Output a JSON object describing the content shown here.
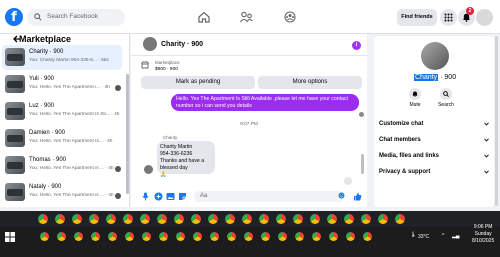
{
  "top": {
    "logo": "f",
    "search_placeholder": "Search Facebook",
    "find_friends": "Find friends",
    "notif_count": "2"
  },
  "left": {
    "title": "Marketplace",
    "conversations": [
      {
        "name": "Charity · 900",
        "preview": "You: Charity Martin 954-336-6...",
        "time": "5bs"
      },
      {
        "name": "Yuli · 900",
        "preview": "You: Hello. Yes The Apartment i...",
        "time": "4h"
      },
      {
        "name": "Luz · 900",
        "preview": "You: Hello. Yes The Apartment Is Sti...",
        "time": "4h"
      },
      {
        "name": "Damien · 900",
        "preview": "You: Hello. Yes The Apartment Is...",
        "time": "4h"
      },
      {
        "name": "Thomas · 900",
        "preview": "You: Hello. Yes The Apartment is ...",
        "time": "4h"
      },
      {
        "name": "Nataly · 900",
        "preview": "You: Hello. Yes The Apartment is ...",
        "time": "4h"
      }
    ]
  },
  "chat": {
    "name": "Charity · 900",
    "info": "i",
    "listing_label": "Marketplace",
    "listing_detail": "$900 · 900",
    "mark_pending": "Mark as pending",
    "more_options": "More options",
    "outgoing": "Hello. Yes The Apartment Is Still Available ,please let me have your contact number so i can send you details",
    "timestamp": "9:07 PM",
    "sender": "Charity",
    "incoming_line1": "Charity Martin",
    "incoming_line2": "954-336-6236",
    "incoming_line3": "Thanks and have a blessed day",
    "incoming_emoji": "🙏",
    "composer_placeholder": "Aa"
  },
  "right": {
    "name_highlight": "Charity",
    "name_rest": " · 900",
    "mute": "Mute",
    "search": "Search",
    "rows": [
      "Customize chat",
      "Chat members",
      "Media, files and links",
      "Privacy & support"
    ]
  },
  "taskbar": {
    "temp": "33°C",
    "time": "9:06 PM",
    "day": "Sunday",
    "date": "8/10/2025"
  },
  "colors": {
    "brand": "#1877f2",
    "bubble": "#9b2cf0",
    "badge": "#e41e3f"
  }
}
